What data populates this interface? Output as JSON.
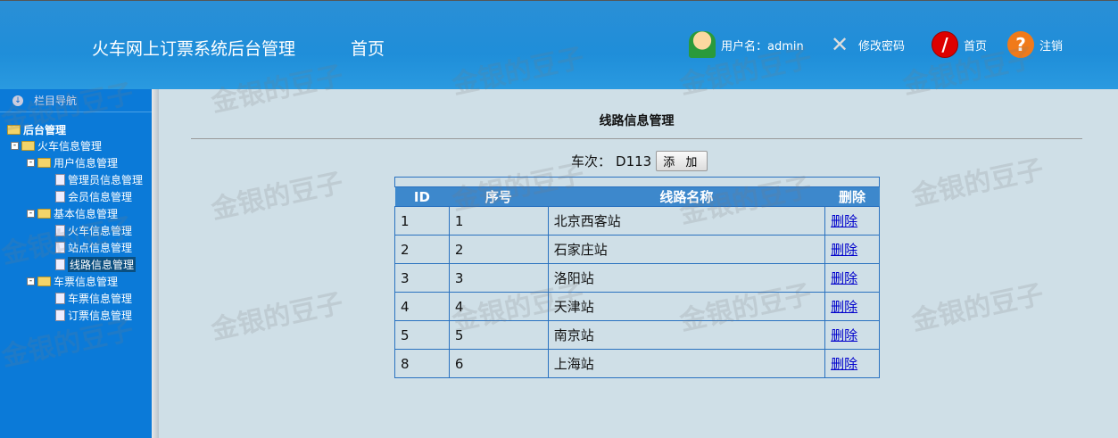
{
  "header": {
    "title": "火车网上订票系统后台管理",
    "home": "首页",
    "user_label": "用户名：admin",
    "change_password": "修改密码",
    "home_link": "首页",
    "logout": "注销"
  },
  "sidebar": {
    "nav_title": "栏目导航",
    "root": "后台管理",
    "tree": [
      {
        "label": "火车信息管理"
      },
      {
        "label": "用户信息管理"
      },
      {
        "label": "管理员信息管理"
      },
      {
        "label": "会员信息管理"
      },
      {
        "label": "基本信息管理"
      },
      {
        "label": "火车信息管理"
      },
      {
        "label": "站点信息管理"
      },
      {
        "label": "线路信息管理"
      },
      {
        "label": "车票信息管理"
      },
      {
        "label": "车票信息管理"
      },
      {
        "label": "订票信息管理"
      }
    ]
  },
  "main": {
    "title": "线路信息管理",
    "train_label": "车次：",
    "train_value": "D113",
    "add_button": "添 加",
    "columns": [
      "ID",
      "序号",
      "线路名称",
      "删除"
    ],
    "rows": [
      {
        "id": "1",
        "seq": "1",
        "name": "北京西客站",
        "action": "删除"
      },
      {
        "id": "2",
        "seq": "2",
        "name": "石家庄站",
        "action": "删除"
      },
      {
        "id": "3",
        "seq": "3",
        "name": "洛阳站",
        "action": "删除"
      },
      {
        "id": "4",
        "seq": "4",
        "name": "天津站",
        "action": "删除"
      },
      {
        "id": "5",
        "seq": "5",
        "name": "南京站",
        "action": "删除"
      },
      {
        "id": "8",
        "seq": "6",
        "name": "上海站",
        "action": "删除"
      }
    ]
  },
  "watermark": "金银的豆子"
}
